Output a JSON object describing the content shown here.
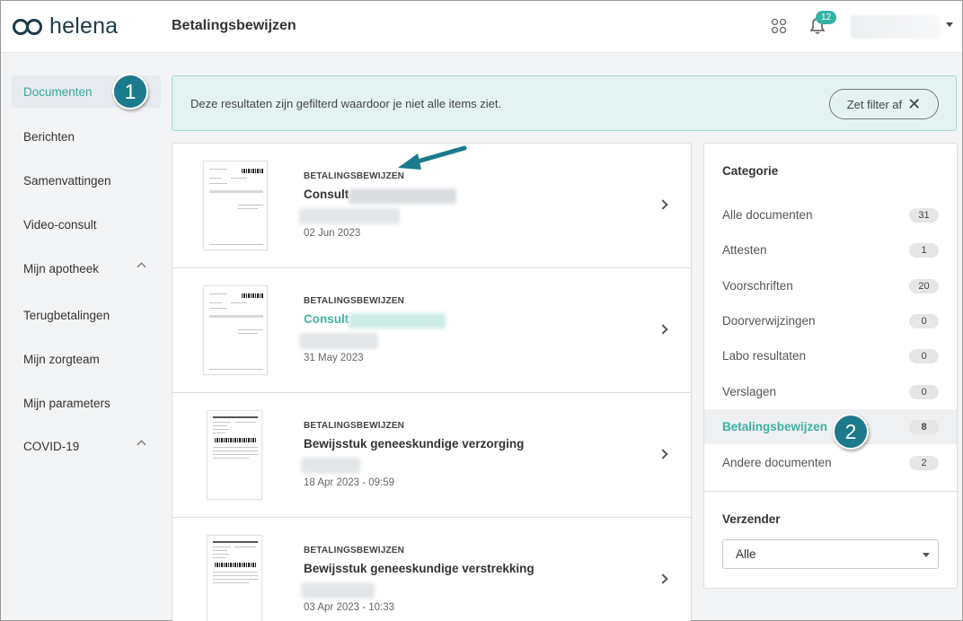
{
  "header": {
    "logo_text": "helena",
    "page_title": "Betalingsbewijzen",
    "notification_count": "12",
    "icons": [
      "helena-logo-icon",
      "apps-grid-icon",
      "bell-icon",
      "chevron-down-icon"
    ]
  },
  "sidebar": {
    "items": [
      {
        "label": "Documenten",
        "active": true
      },
      {
        "label": "Berichten"
      },
      {
        "label": "Samenvattingen"
      },
      {
        "label": "Video-consult"
      },
      {
        "label": "Mijn apotheek",
        "expandable": true
      },
      {
        "label": "Terugbetalingen"
      },
      {
        "label": "Mijn zorgteam"
      },
      {
        "label": "Mijn parameters"
      },
      {
        "label": "COVID-19",
        "expandable": true
      }
    ]
  },
  "annotations": {
    "step1": "1",
    "step2": "2"
  },
  "filter": {
    "message": "Deze resultaten zijn gefilterd waardoor je niet alle items ziet.",
    "button_label": "Zet filter af"
  },
  "documents": [
    {
      "category": "BETALINGSBEWIJZEN",
      "title": "Consult",
      "date": "02 Jun 2023"
    },
    {
      "category": "BETALINGSBEWIJZEN",
      "title": "Consult",
      "date": "31 May 2023"
    },
    {
      "category": "BETALINGSBEWIJZEN",
      "title": "Bewijsstuk geneeskundige verzorging",
      "date": "18 Apr 2023 - 09:59"
    },
    {
      "category": "BETALINGSBEWIJZEN",
      "title": "Bewijsstuk geneeskundige verstrekking",
      "date": "03 Apr 2023 - 10:33"
    }
  ],
  "categories_panel": {
    "heading": "Categorie",
    "items": [
      {
        "label": "Alle documenten",
        "count": "31"
      },
      {
        "label": "Attesten",
        "count": "1"
      },
      {
        "label": "Voorschriften",
        "count": "20"
      },
      {
        "label": "Doorverwijzingen",
        "count": "0"
      },
      {
        "label": "Labo resultaten",
        "count": "0"
      },
      {
        "label": "Verslagen",
        "count": "0"
      },
      {
        "label": "Betalingsbewijzen",
        "count": "8",
        "active": true
      },
      {
        "label": "Andere documenten",
        "count": "2"
      }
    ],
    "sender_heading": "Verzender",
    "sender_selected": "Alle"
  },
  "colors": {
    "accent": "#3fb2a3",
    "annotation": "#1b7a8c",
    "banner": "#e4f2f2"
  }
}
